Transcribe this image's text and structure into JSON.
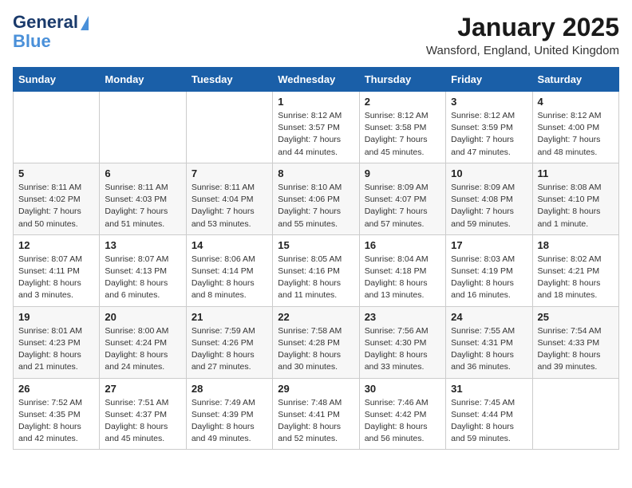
{
  "logo": {
    "line1": "General",
    "line2": "Blue"
  },
  "title": "January 2025",
  "location": "Wansford, England, United Kingdom",
  "days_of_week": [
    "Sunday",
    "Monday",
    "Tuesday",
    "Wednesday",
    "Thursday",
    "Friday",
    "Saturday"
  ],
  "weeks": [
    [
      {
        "day": "",
        "sunrise": "",
        "sunset": "",
        "daylight": ""
      },
      {
        "day": "",
        "sunrise": "",
        "sunset": "",
        "daylight": ""
      },
      {
        "day": "",
        "sunrise": "",
        "sunset": "",
        "daylight": ""
      },
      {
        "day": "1",
        "sunrise": "Sunrise: 8:12 AM",
        "sunset": "Sunset: 3:57 PM",
        "daylight": "Daylight: 7 hours and 44 minutes."
      },
      {
        "day": "2",
        "sunrise": "Sunrise: 8:12 AM",
        "sunset": "Sunset: 3:58 PM",
        "daylight": "Daylight: 7 hours and 45 minutes."
      },
      {
        "day": "3",
        "sunrise": "Sunrise: 8:12 AM",
        "sunset": "Sunset: 3:59 PM",
        "daylight": "Daylight: 7 hours and 47 minutes."
      },
      {
        "day": "4",
        "sunrise": "Sunrise: 8:12 AM",
        "sunset": "Sunset: 4:00 PM",
        "daylight": "Daylight: 7 hours and 48 minutes."
      }
    ],
    [
      {
        "day": "5",
        "sunrise": "Sunrise: 8:11 AM",
        "sunset": "Sunset: 4:02 PM",
        "daylight": "Daylight: 7 hours and 50 minutes."
      },
      {
        "day": "6",
        "sunrise": "Sunrise: 8:11 AM",
        "sunset": "Sunset: 4:03 PM",
        "daylight": "Daylight: 7 hours and 51 minutes."
      },
      {
        "day": "7",
        "sunrise": "Sunrise: 8:11 AM",
        "sunset": "Sunset: 4:04 PM",
        "daylight": "Daylight: 7 hours and 53 minutes."
      },
      {
        "day": "8",
        "sunrise": "Sunrise: 8:10 AM",
        "sunset": "Sunset: 4:06 PM",
        "daylight": "Daylight: 7 hours and 55 minutes."
      },
      {
        "day": "9",
        "sunrise": "Sunrise: 8:09 AM",
        "sunset": "Sunset: 4:07 PM",
        "daylight": "Daylight: 7 hours and 57 minutes."
      },
      {
        "day": "10",
        "sunrise": "Sunrise: 8:09 AM",
        "sunset": "Sunset: 4:08 PM",
        "daylight": "Daylight: 7 hours and 59 minutes."
      },
      {
        "day": "11",
        "sunrise": "Sunrise: 8:08 AM",
        "sunset": "Sunset: 4:10 PM",
        "daylight": "Daylight: 8 hours and 1 minute."
      }
    ],
    [
      {
        "day": "12",
        "sunrise": "Sunrise: 8:07 AM",
        "sunset": "Sunset: 4:11 PM",
        "daylight": "Daylight: 8 hours and 3 minutes."
      },
      {
        "day": "13",
        "sunrise": "Sunrise: 8:07 AM",
        "sunset": "Sunset: 4:13 PM",
        "daylight": "Daylight: 8 hours and 6 minutes."
      },
      {
        "day": "14",
        "sunrise": "Sunrise: 8:06 AM",
        "sunset": "Sunset: 4:14 PM",
        "daylight": "Daylight: 8 hours and 8 minutes."
      },
      {
        "day": "15",
        "sunrise": "Sunrise: 8:05 AM",
        "sunset": "Sunset: 4:16 PM",
        "daylight": "Daylight: 8 hours and 11 minutes."
      },
      {
        "day": "16",
        "sunrise": "Sunrise: 8:04 AM",
        "sunset": "Sunset: 4:18 PM",
        "daylight": "Daylight: 8 hours and 13 minutes."
      },
      {
        "day": "17",
        "sunrise": "Sunrise: 8:03 AM",
        "sunset": "Sunset: 4:19 PM",
        "daylight": "Daylight: 8 hours and 16 minutes."
      },
      {
        "day": "18",
        "sunrise": "Sunrise: 8:02 AM",
        "sunset": "Sunset: 4:21 PM",
        "daylight": "Daylight: 8 hours and 18 minutes."
      }
    ],
    [
      {
        "day": "19",
        "sunrise": "Sunrise: 8:01 AM",
        "sunset": "Sunset: 4:23 PM",
        "daylight": "Daylight: 8 hours and 21 minutes."
      },
      {
        "day": "20",
        "sunrise": "Sunrise: 8:00 AM",
        "sunset": "Sunset: 4:24 PM",
        "daylight": "Daylight: 8 hours and 24 minutes."
      },
      {
        "day": "21",
        "sunrise": "Sunrise: 7:59 AM",
        "sunset": "Sunset: 4:26 PM",
        "daylight": "Daylight: 8 hours and 27 minutes."
      },
      {
        "day": "22",
        "sunrise": "Sunrise: 7:58 AM",
        "sunset": "Sunset: 4:28 PM",
        "daylight": "Daylight: 8 hours and 30 minutes."
      },
      {
        "day": "23",
        "sunrise": "Sunrise: 7:56 AM",
        "sunset": "Sunset: 4:30 PM",
        "daylight": "Daylight: 8 hours and 33 minutes."
      },
      {
        "day": "24",
        "sunrise": "Sunrise: 7:55 AM",
        "sunset": "Sunset: 4:31 PM",
        "daylight": "Daylight: 8 hours and 36 minutes."
      },
      {
        "day": "25",
        "sunrise": "Sunrise: 7:54 AM",
        "sunset": "Sunset: 4:33 PM",
        "daylight": "Daylight: 8 hours and 39 minutes."
      }
    ],
    [
      {
        "day": "26",
        "sunrise": "Sunrise: 7:52 AM",
        "sunset": "Sunset: 4:35 PM",
        "daylight": "Daylight: 8 hours and 42 minutes."
      },
      {
        "day": "27",
        "sunrise": "Sunrise: 7:51 AM",
        "sunset": "Sunset: 4:37 PM",
        "daylight": "Daylight: 8 hours and 45 minutes."
      },
      {
        "day": "28",
        "sunrise": "Sunrise: 7:49 AM",
        "sunset": "Sunset: 4:39 PM",
        "daylight": "Daylight: 8 hours and 49 minutes."
      },
      {
        "day": "29",
        "sunrise": "Sunrise: 7:48 AM",
        "sunset": "Sunset: 4:41 PM",
        "daylight": "Daylight: 8 hours and 52 minutes."
      },
      {
        "day": "30",
        "sunrise": "Sunrise: 7:46 AM",
        "sunset": "Sunset: 4:42 PM",
        "daylight": "Daylight: 8 hours and 56 minutes."
      },
      {
        "day": "31",
        "sunrise": "Sunrise: 7:45 AM",
        "sunset": "Sunset: 4:44 PM",
        "daylight": "Daylight: 8 hours and 59 minutes."
      },
      {
        "day": "",
        "sunrise": "",
        "sunset": "",
        "daylight": ""
      }
    ]
  ]
}
